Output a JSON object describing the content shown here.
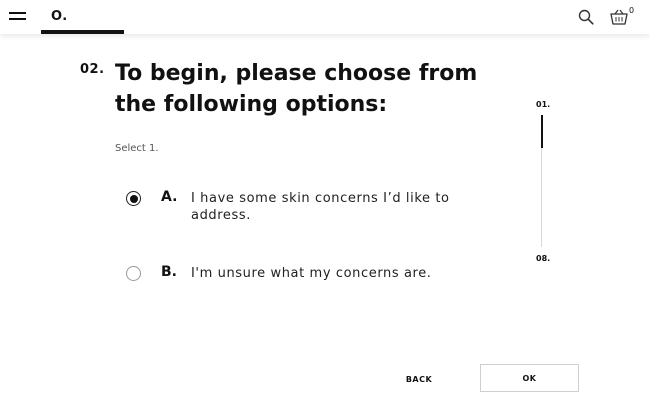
{
  "header": {
    "logo": "O.",
    "cart_count": "0",
    "icons": {
      "menu": "hamburger-menu-icon",
      "search": "search-icon",
      "cart": "basket-icon"
    }
  },
  "question": {
    "step": "02.",
    "title": "To begin, please choose from the following options:",
    "instruction": "Select 1."
  },
  "options": [
    {
      "letter": "A.",
      "text": "I have some skin concerns I’d like to address.",
      "selected": true
    },
    {
      "letter": "B.",
      "text": "I'm unsure what my concerns are.",
      "selected": false
    }
  ],
  "progress": {
    "start_label": "01.",
    "end_label": "08.",
    "fraction": 0.25
  },
  "navigation": {
    "back_label": "BACK",
    "ok_label": "OK"
  }
}
